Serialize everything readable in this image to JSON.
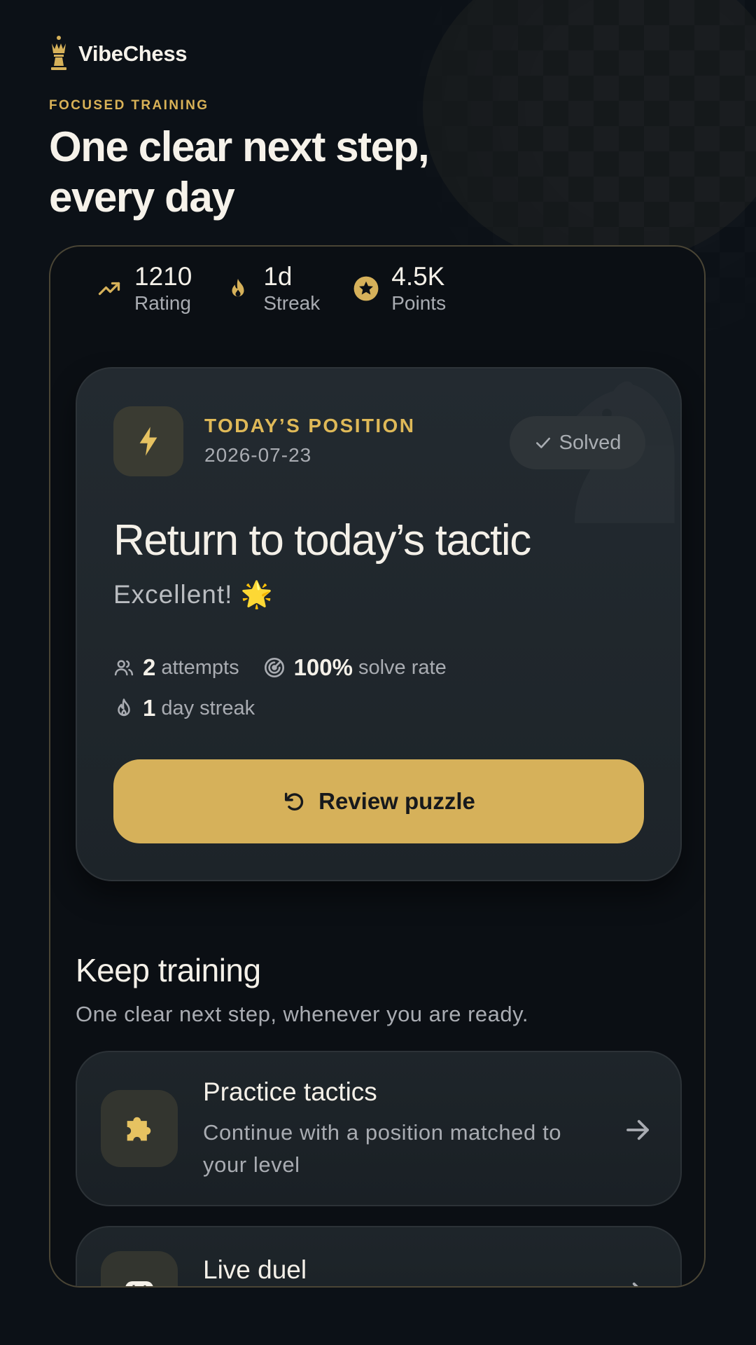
{
  "brand": {
    "name": "VibeChess",
    "logo_icon": "queen-icon"
  },
  "hero": {
    "eyebrow": "FOCUSED TRAINING",
    "title_line1": "One clear next step,",
    "title_line2": "every day"
  },
  "stats": [
    {
      "icon": "trending-up-icon",
      "value": "1210",
      "label": "Rating"
    },
    {
      "icon": "flame-icon",
      "value": "1d",
      "label": "Streak"
    },
    {
      "icon": "star-icon",
      "value": "4.5K",
      "label": "Points"
    }
  ],
  "daily": {
    "eyebrow": "TODAY’S POSITION",
    "date": "2026-07-23",
    "status": "Solved",
    "title": "Return to today’s tactic",
    "message": "Excellent! 🌟",
    "attempts_value": "2",
    "attempts_label": "attempts",
    "solve_rate_value": "100%",
    "solve_rate_label": "solve rate",
    "streak_value": "1",
    "streak_label": "day streak",
    "cta": "Review puzzle"
  },
  "training": {
    "title": "Keep training",
    "subtitle": "One clear next step, whenever you are ready.",
    "items": [
      {
        "title": "Practice tactics",
        "description": "Continue with a position matched to your level",
        "icon": "puzzle-icon"
      },
      {
        "title": "Live duel",
        "description": "",
        "icon": "gamepad-icon"
      }
    ]
  },
  "colors": {
    "accent": "#d6b15a",
    "background": "#0c1117",
    "card": "#20272c"
  }
}
